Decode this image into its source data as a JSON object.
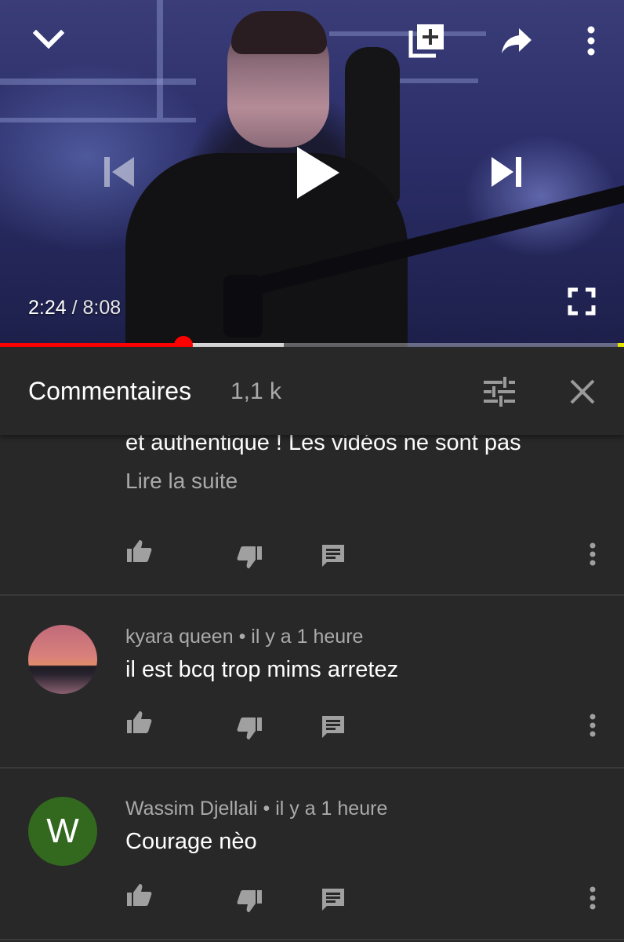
{
  "player": {
    "current_time": "2:24",
    "separator": "/",
    "duration": "8:08",
    "progress_played": 0.294,
    "progress_buffered": 0.455,
    "icons": {
      "minimize": "chevron-down-icon",
      "add_to_playlist": "playlist-add-icon",
      "share": "share-icon",
      "more": "more-vert-icon",
      "previous": "skip-previous-icon",
      "play": "play-icon",
      "next": "skip-next-icon",
      "fullscreen": "fullscreen-icon"
    }
  },
  "comments_panel": {
    "title": "Commentaires",
    "count": "1,1 k",
    "icons": {
      "sort": "sort-filter-icon",
      "close": "close-icon"
    }
  },
  "comments": [
    {
      "text": "et authentique ! Les vidéos ne sont pas",
      "read_more": "Lire la suite"
    },
    {
      "author": "kyara queen",
      "meta_separator": "•",
      "time": "il y a 1 heure",
      "text": "il est bcq trop mims arretez"
    },
    {
      "author": "Wassim Djellali",
      "meta_separator": "•",
      "time": "il y a 1 heure",
      "text": "Courage nèo",
      "avatar_letter": "W",
      "avatar_color": "#33691e"
    }
  ],
  "colors": {
    "background": "#282828",
    "progress": "#ff0000",
    "secondary_text": "#aaaaaa"
  }
}
